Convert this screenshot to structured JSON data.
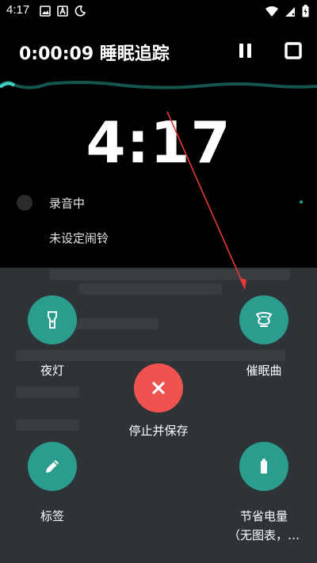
{
  "status_bar": {
    "time": "4:17"
  },
  "header": {
    "title": "0:00:09 睡眠追踪"
  },
  "clock": {
    "time": "4:17"
  },
  "info": {
    "recording": "录音中",
    "alarm": "未设定闹铃"
  },
  "actions": {
    "flashlight": "夜灯",
    "hypnosis": "催眠曲",
    "stop_save": "停止并保存",
    "tag": "标签",
    "power_save_line1": "节省电量",
    "power_save_line2": "（无图表，…"
  },
  "colors": {
    "accent": "#2a9d8f",
    "danger": "#ef5350",
    "panel": "#2e3338",
    "arrow": "#e53935"
  }
}
